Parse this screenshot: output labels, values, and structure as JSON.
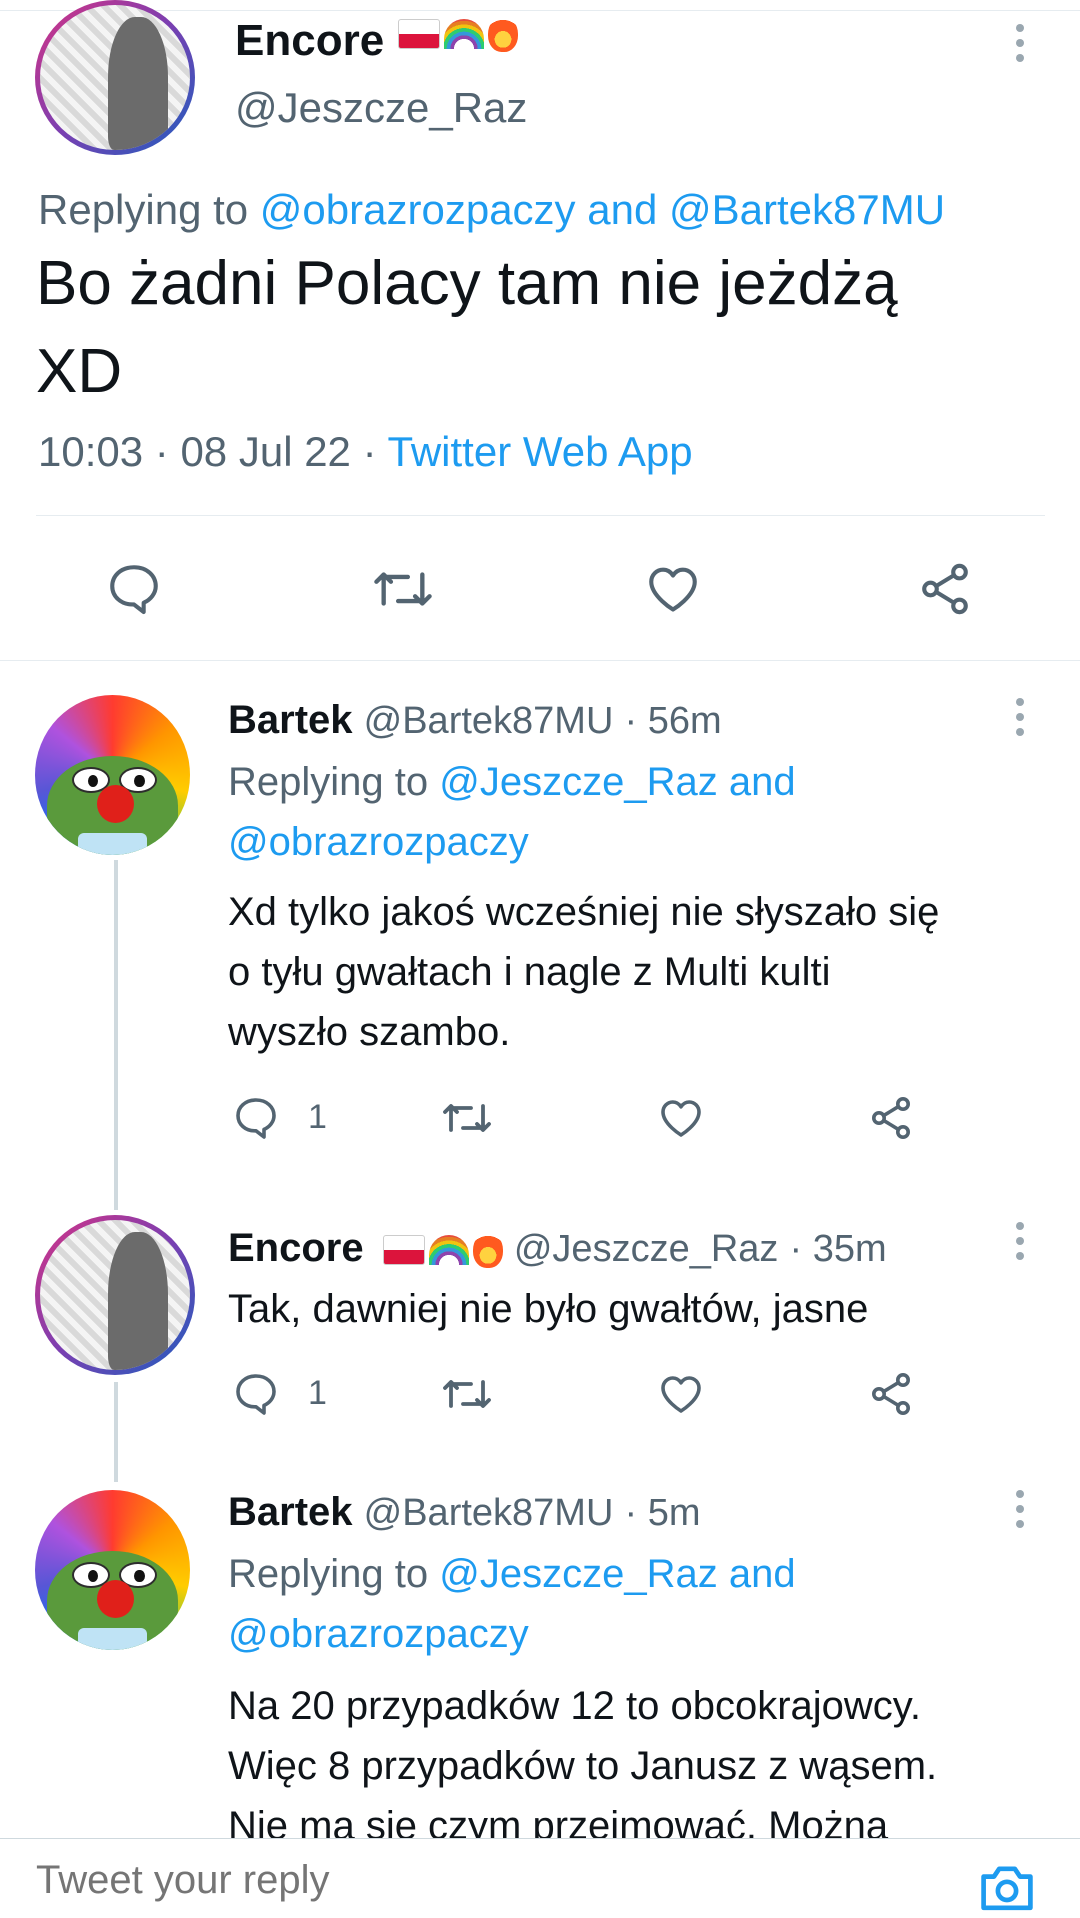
{
  "main_tweet": {
    "name": "Encore",
    "handle": "@Jeszcze_Raz",
    "replying_prefix": "Replying to",
    "replying_to": "@obrazrozpaczy and @Bartek87MU",
    "text_line1": "Bo żadni Polacy tam nie jeżdżą",
    "text_line2": "XD",
    "time": "10:03",
    "date": "08 Jul 22",
    "separator": "·",
    "source": "Twitter Web App",
    "icons": [
      "reply-icon",
      "retweet-icon",
      "like-icon",
      "share-icon"
    ]
  },
  "replies": [
    {
      "name": "Bartek",
      "handle": "@Bartek87MU",
      "time": "· 56m",
      "replying_prefix": "Replying to",
      "replying_line1": "@Jeszcze_Raz and",
      "replying_line2": "@obrazrozpaczy",
      "lines": [
        "Xd tylko jakoś wcześniej nie słyszało się",
        "o tyłu gwałtach i nagle z Multi kulti",
        "wyszło szambo."
      ],
      "reply_count": "1"
    },
    {
      "name": "Encore",
      "handle": "@Jeszcze_Raz",
      "time": "· 35m",
      "lines": [
        "Tak, dawniej nie było gwałtów, jasne"
      ],
      "reply_count": "1"
    },
    {
      "name": "Bartek",
      "handle": "@Bartek87MU",
      "time": "· 5m",
      "replying_prefix": "Replying to",
      "replying_line1": "@Jeszcze_Raz and",
      "replying_line2": "@obrazrozpaczy",
      "lines": [
        "Na 20 przypadków 12 to obcokrajowcy.",
        "Więc 8 przypadków to Janusz z wąsem.",
        "Nie ma się czym przejmować. Można"
      ]
    }
  ],
  "composer": {
    "placeholder": "Tweet your reply",
    "icon": "camera-icon"
  },
  "colors": {
    "accent": "#1d9bf0",
    "muted": "#536471",
    "text": "#0f1419"
  }
}
